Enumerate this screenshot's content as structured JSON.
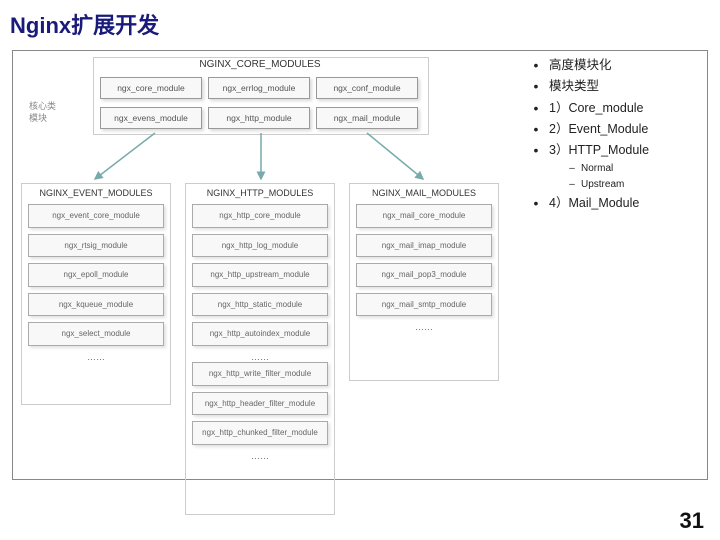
{
  "title": "Nginx扩展开发",
  "page_number": "31",
  "diagram": {
    "core_header": "NGINX_CORE_MODULES",
    "side_label_l1": "核心类",
    "side_label_l2": "模块",
    "core_row1": [
      "ngx_core_module",
      "ngx_errlog_module",
      "ngx_conf_module"
    ],
    "core_row2": [
      "ngx_evens_module",
      "ngx_http_module",
      "ngx_mail_module"
    ],
    "col_event": {
      "header": "NGINX_EVENT_MODULES",
      "boxes": [
        "ngx_event_core_module",
        "ngx_rtsig_module",
        "ngx_epoll_module",
        "ngx_kqueue_module",
        "ngx_select_module"
      ],
      "ellipsis": "……"
    },
    "col_http": {
      "header": "NGINX_HTTP_MODULES",
      "boxes": [
        "ngx_http_core_module",
        "ngx_http_log_module",
        "ngx_http_upstream_module",
        "ngx_http_static_module",
        "ngx_http_autoindex_module"
      ],
      "mid_ellipsis": "……",
      "filter_boxes": [
        "ngx_http_write_filter_module",
        "ngx_http_header_filter_module",
        "ngx_http_chunked_filter_module"
      ],
      "ellipsis": "……"
    },
    "col_mail": {
      "header": "NGINX_MAIL_MODULES",
      "boxes": [
        "ngx_mail_core_module",
        "ngx_mail_imap_module",
        "ngx_mail_pop3_module",
        "ngx_mail_smtp_module"
      ],
      "ellipsis": "……"
    }
  },
  "bullets": {
    "b1": "高度模块化",
    "b2": "模块类型",
    "b3": "1）Core_module",
    "b4": "2）Event_Module",
    "b5": "3）HTTP_Module",
    "s1": "Normal",
    "s2": "Upstream",
    "b6": "4）Mail_Module"
  }
}
